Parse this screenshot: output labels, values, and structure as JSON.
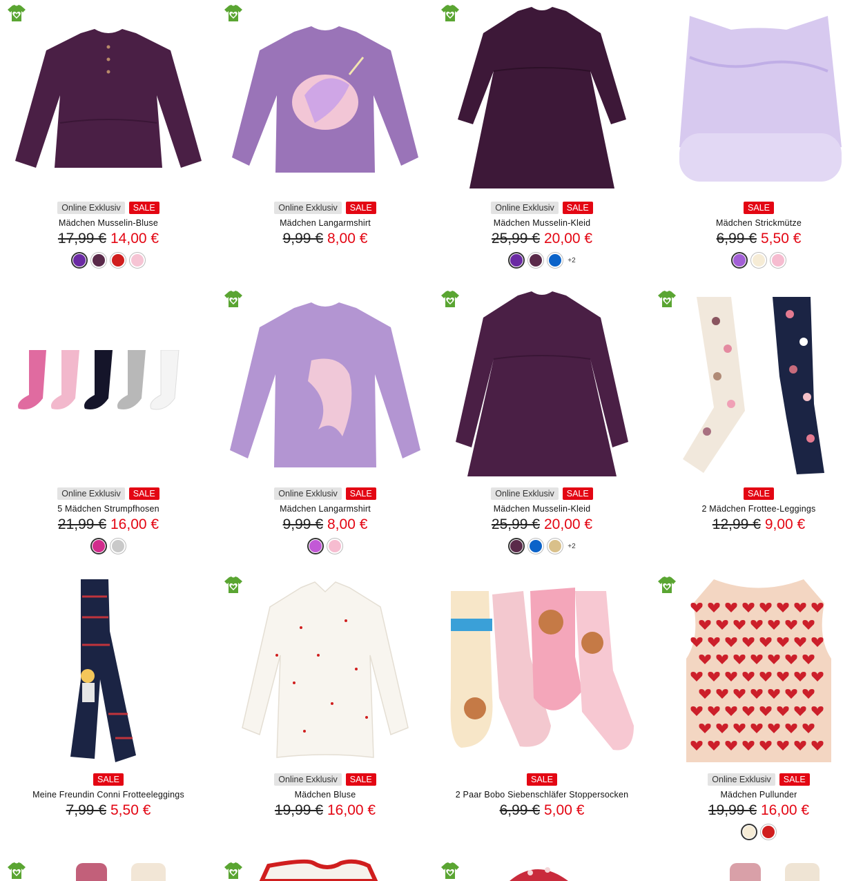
{
  "colors": {
    "sale": "#e30613",
    "online_badge": "#e3e3e3",
    "eco_green": "#5aa532"
  },
  "products": [
    {
      "name": "Mädchen Musselin-Bluse",
      "online": "Online Exklusiv",
      "sale": "SALE",
      "old_price": "17,99 €",
      "new_price": "14,00 €",
      "swatches": [
        "#6b2aa3",
        "#5a2a4a",
        "#d01e1e",
        "#f6c4d4"
      ],
      "more": "",
      "icon": "musselin-blouse-image"
    },
    {
      "name": "Mädchen Langarmshirt",
      "online": "Online Exklusiv",
      "sale": "SALE",
      "old_price": "9,99 €",
      "new_price": "8,00 €",
      "swatches": [],
      "more": "",
      "icon": "unicorn-shirt-image"
    },
    {
      "name": "Mädchen Musselin-Kleid",
      "online": "Online Exklusiv",
      "sale": "SALE",
      "old_price": "25,99 €",
      "new_price": "20,00 €",
      "swatches": [
        "#6b2aa3",
        "#5a2a4a",
        "#0b63c9"
      ],
      "more": "+2",
      "icon": "musselin-dress-image"
    },
    {
      "name": "Mädchen Strickmütze",
      "online": "",
      "sale": "SALE",
      "old_price": "6,99 €",
      "new_price": "5,50 €",
      "swatches": [
        "#a35fd6",
        "#f6ecd6",
        "#f6bcd0"
      ],
      "more": "",
      "icon": "knit-hat-image"
    },
    {
      "name": "5 Mädchen Strumpfhosen",
      "online": "Online Exklusiv",
      "sale": "SALE",
      "old_price": "21,99 €",
      "new_price": "16,00 €",
      "swatches": [
        "#d12c8c",
        "#c9c9c9"
      ],
      "more": "",
      "icon": "tights-image"
    },
    {
      "name": "Mädchen Langarmshirt",
      "online": "Online Exklusiv",
      "sale": "SALE",
      "old_price": "9,99 €",
      "new_price": "8,00 €",
      "swatches": [
        "#c259d6",
        "#f6bcd0"
      ],
      "more": "",
      "icon": "unicorn-shirt-image"
    },
    {
      "name": "Mädchen Musselin-Kleid",
      "online": "Online Exklusiv",
      "sale": "SALE",
      "old_price": "25,99 €",
      "new_price": "20,00 €",
      "swatches": [
        "#5a2a4a",
        "#0b63c9",
        "#d9c08a"
      ],
      "more": "+2",
      "icon": "musselin-dress-image"
    },
    {
      "name": "2 Mädchen Frottee-Leggings",
      "online": "",
      "sale": "SALE",
      "old_price": "12,99 €",
      "new_price": "9,00 €",
      "swatches": [],
      "more": "",
      "icon": "dotted-leggings-image"
    },
    {
      "name": "Meine Freundin Conni Frotteeleggings",
      "online": "",
      "sale": "SALE",
      "old_price": "7,99 €",
      "new_price": "5,50 €",
      "swatches": [],
      "more": "",
      "icon": "conni-leggings-image"
    },
    {
      "name": "Mädchen Bluse",
      "online": "Online Exklusiv",
      "sale": "SALE",
      "old_price": "19,99 €",
      "new_price": "16,00 €",
      "swatches": [],
      "more": "",
      "icon": "white-blouse-image"
    },
    {
      "name": "2 Paar Bobo Siebenschläfer Stoppersocken",
      "online": "",
      "sale": "SALE",
      "old_price": "6,99 €",
      "new_price": "5,00 €",
      "swatches": [],
      "more": "",
      "icon": "bobo-socks-image"
    },
    {
      "name": "Mädchen Pullunder",
      "online": "Online Exklusiv",
      "sale": "SALE",
      "old_price": "19,99 €",
      "new_price": "16,00 €",
      "swatches": [
        "#f6ecd6",
        "#d01e1e"
      ],
      "more": "",
      "icon": "heart-vest-image"
    }
  ]
}
